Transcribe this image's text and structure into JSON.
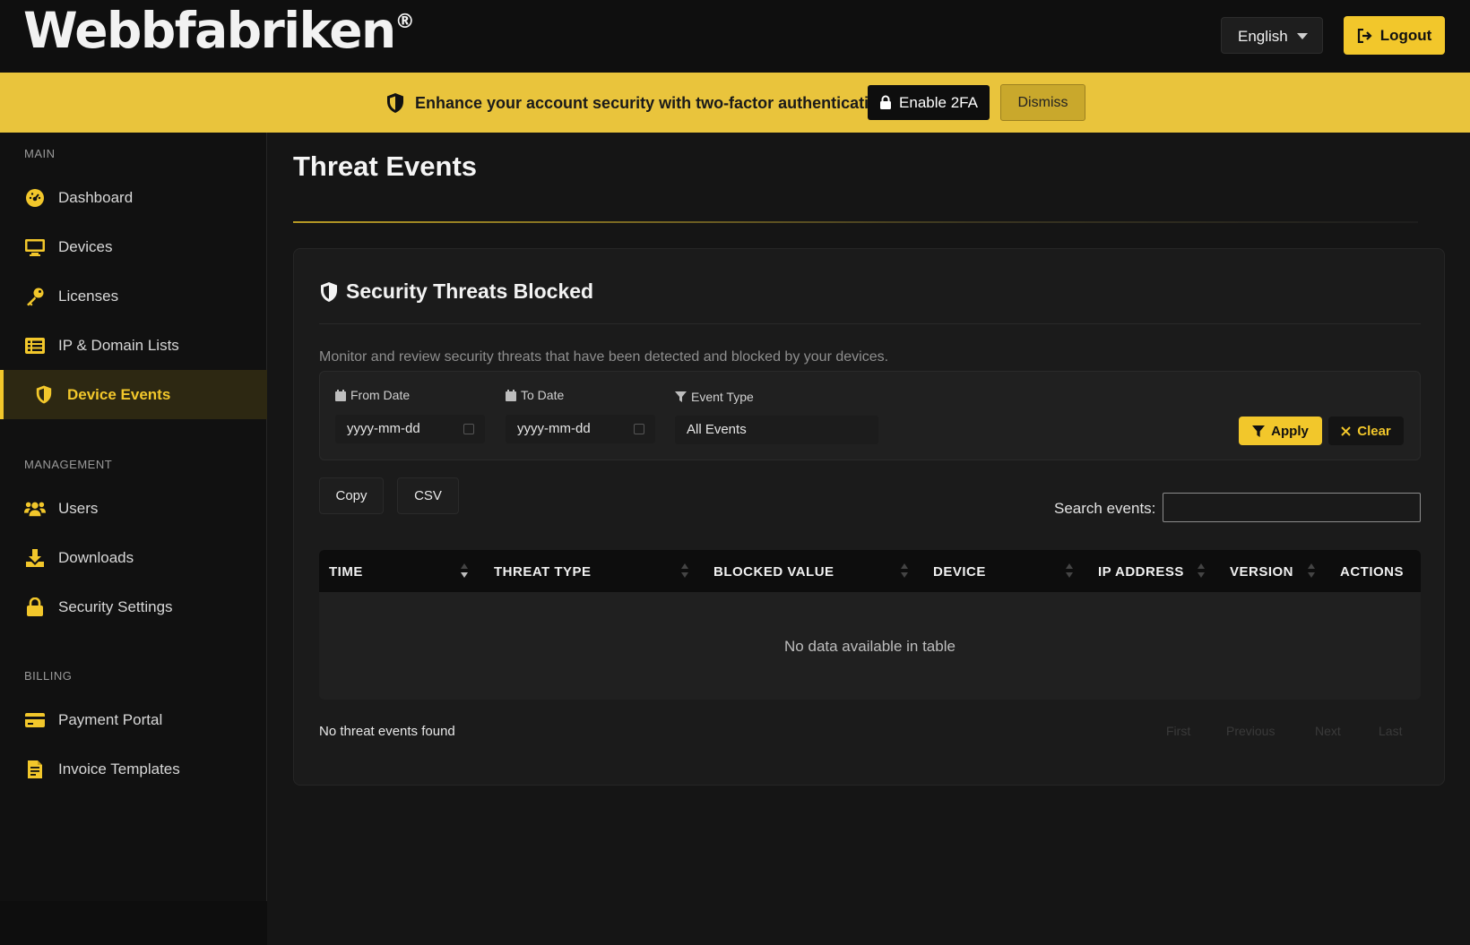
{
  "header": {
    "logo": "Webbfabriken",
    "logo_mark": "®",
    "language": "English",
    "logout_label": "Logout"
  },
  "banner": {
    "text": "Enhance your account security with two-factor authentication",
    "enable_label": "Enable 2FA",
    "dismiss_label": "Dismiss",
    "color": "#e9c43c"
  },
  "sidebar": {
    "sections": [
      {
        "label": "MAIN",
        "items": [
          {
            "label": "Dashboard",
            "icon": "gauge-icon"
          },
          {
            "label": "Devices",
            "icon": "monitor-icon"
          },
          {
            "label": "Licenses",
            "icon": "key-icon"
          },
          {
            "label": "IP & Domain Lists",
            "icon": "list-icon"
          },
          {
            "label": "Device Events",
            "icon": "shield-icon",
            "active": true
          }
        ]
      },
      {
        "label": "MANAGEMENT",
        "items": [
          {
            "label": "Users",
            "icon": "users-icon"
          },
          {
            "label": "Downloads",
            "icon": "download-icon"
          },
          {
            "label": "Security Settings",
            "icon": "lock-icon"
          }
        ]
      },
      {
        "label": "BILLING",
        "items": [
          {
            "label": "Payment Portal",
            "icon": "credit-card-icon"
          },
          {
            "label": "Invoice Templates",
            "icon": "file-invoice-icon"
          }
        ]
      }
    ]
  },
  "main": {
    "title": "Threat Events",
    "card": {
      "title": "Security Threats Blocked",
      "description": "Monitor and review security threats that have been detected and blocked by your devices.",
      "filters": {
        "from_label": "From Date",
        "from_value": "yyyy-mm-dd",
        "to_label": "To Date",
        "to_value": "yyyy-mm-dd",
        "type_label": "Event Type",
        "type_value": "All Events",
        "apply_label": "Apply",
        "clear_label": "Clear"
      },
      "export_buttons": [
        "Copy",
        "CSV"
      ],
      "search_label": "Search events:",
      "search_value": "",
      "table": {
        "columns": [
          "TIME",
          "THREAT TYPE",
          "BLOCKED VALUE",
          "DEVICE",
          "IP ADDRESS",
          "VERSION",
          "ACTIONS"
        ],
        "rows": [],
        "empty_text": "No data available in table"
      },
      "info_text": "No threat events found",
      "pagination": [
        "First",
        "Previous",
        "Next",
        "Last"
      ]
    }
  },
  "colors": {
    "accent": "#f2c72b",
    "background": "#151515",
    "sidebar": "#111111"
  }
}
